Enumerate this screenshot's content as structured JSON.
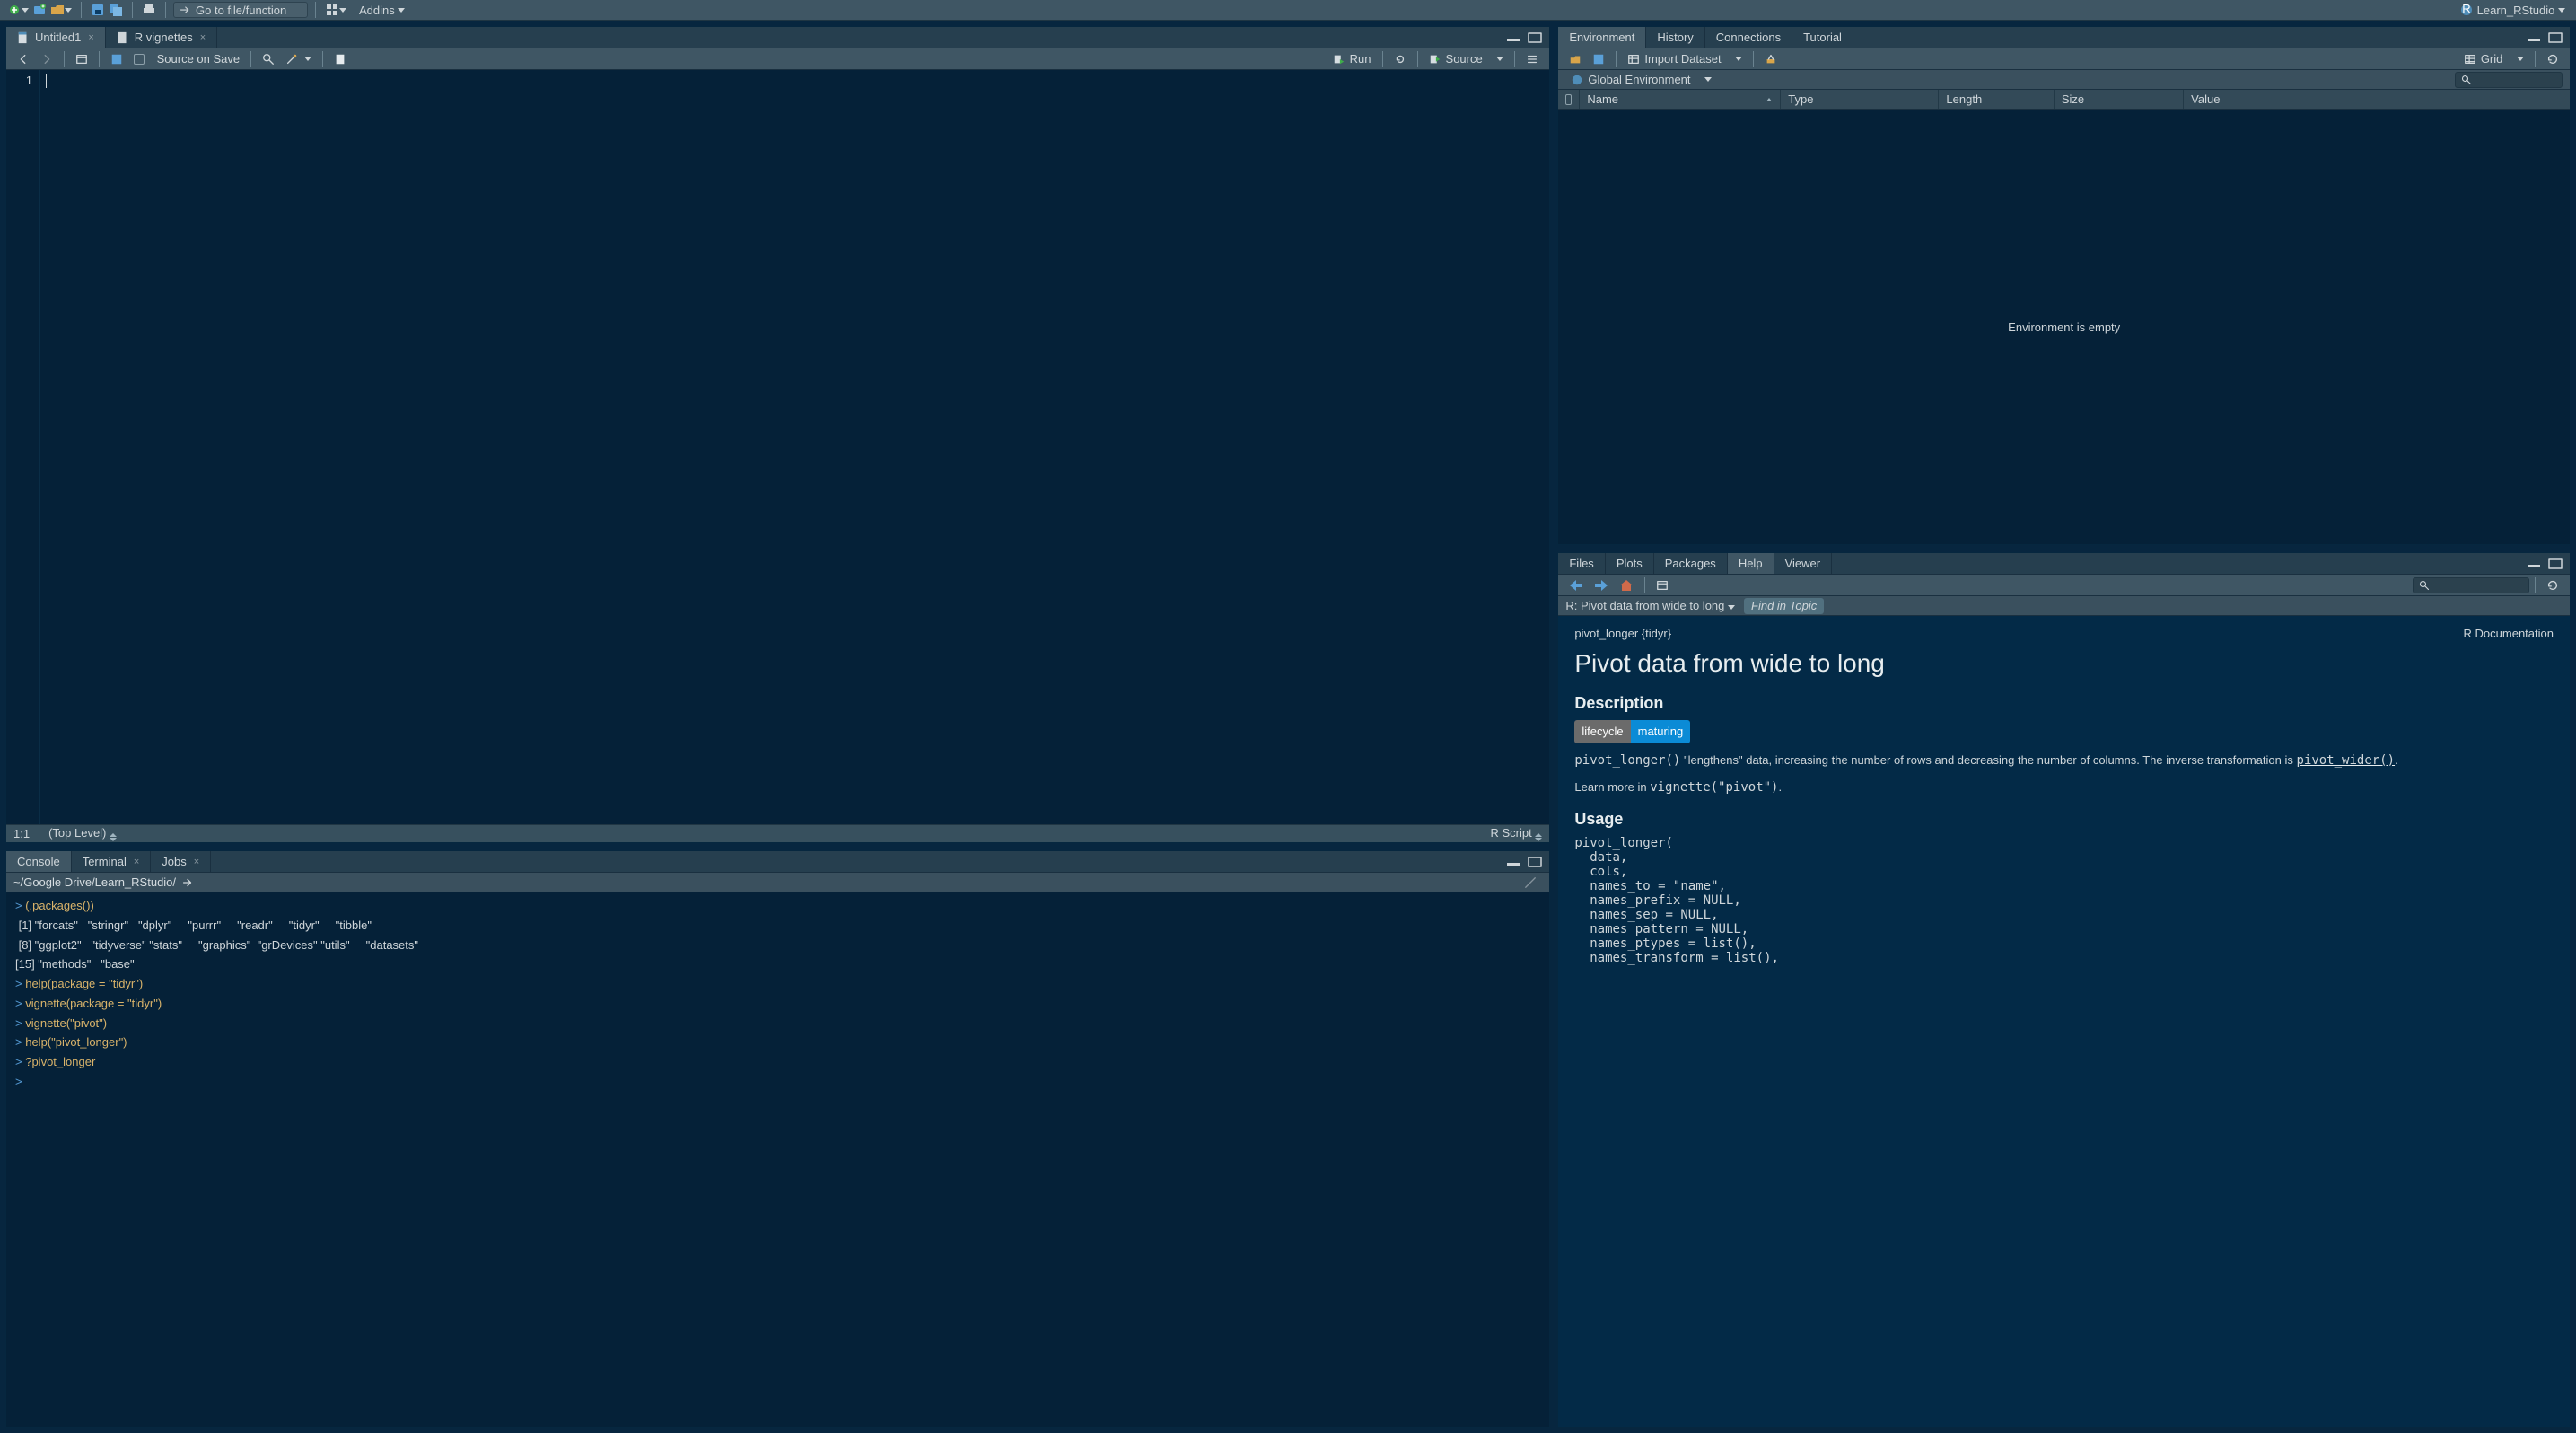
{
  "project_name": "Learn_RStudio",
  "global": {
    "goto_placeholder": "Go to file/function",
    "addins": "Addins"
  },
  "source": {
    "tabs": [
      {
        "label": "Untitled1",
        "close": true
      },
      {
        "label": "R vignettes",
        "close": true
      }
    ],
    "source_on_save": "Source on Save",
    "run": "Run",
    "source_btn": "Source",
    "gutter_first_line": "1",
    "cursor": "1:1",
    "scope": "(Top Level)",
    "lang": "R Script"
  },
  "console": {
    "tabs": [
      "Console",
      "Terminal",
      "Jobs"
    ],
    "wd": "~/Google Drive/Learn_RStudio/",
    "lines": [
      {
        "t": "cmd",
        "prompt": "> ",
        "text": "(.packages())"
      },
      {
        "t": "out",
        "text": " [1] \"forcats\"   \"stringr\"   \"dplyr\"     \"purrr\"     \"readr\"     \"tidyr\"     \"tibble\"   "
      },
      {
        "t": "out",
        "text": " [8] \"ggplot2\"   \"tidyverse\" \"stats\"     \"graphics\"  \"grDevices\" \"utils\"     \"datasets\" "
      },
      {
        "t": "out",
        "text": "[15] \"methods\"   \"base\"     "
      },
      {
        "t": "cmd",
        "prompt": "> ",
        "text": "help(package = \"tidyr\")"
      },
      {
        "t": "cmd",
        "prompt": "> ",
        "text": "vignette(package = \"tidyr\")"
      },
      {
        "t": "cmd",
        "prompt": "> ",
        "text": "vignette(\"pivot\")"
      },
      {
        "t": "cmd",
        "prompt": "> ",
        "text": "help(\"pivot_longer\")"
      },
      {
        "t": "cmd",
        "prompt": "> ",
        "text": "?pivot_longer"
      },
      {
        "t": "cmd",
        "prompt": "> ",
        "text": ""
      }
    ]
  },
  "env": {
    "tabs": [
      "Environment",
      "History",
      "Connections",
      "Tutorial"
    ],
    "import": "Import Dataset",
    "view": "Grid",
    "scope": "Global Environment",
    "cols": [
      "Name",
      "Type",
      "Length",
      "Size",
      "Value"
    ],
    "empty": "Environment is empty"
  },
  "help": {
    "tabs": [
      "Files",
      "Plots",
      "Packages",
      "Help",
      "Viewer"
    ],
    "crumb": "R: Pivot data from wide to long",
    "find_placeholder": "Find in Topic",
    "topic": "pivot_longer {tidyr}",
    "rdoc": "R Documentation",
    "title": "Pivot data from wide to long",
    "h_desc": "Description",
    "badge_l": "lifecycle",
    "badge_r": "maturing",
    "desc_pre": "pivot_longer()",
    "desc_text": " \"lengthens\" data, increasing the number of rows and decreasing the number of columns. The inverse transformation is ",
    "desc_link": "pivot_wider()",
    "learn_pre": "Learn more in ",
    "learn_code": "vignette(\"pivot\")",
    "learn_post": ".",
    "h_usage": "Usage",
    "usage": "pivot_longer(\n  data,\n  cols,\n  names_to = \"name\",\n  names_prefix = NULL,\n  names_sep = NULL,\n  names_pattern = NULL,\n  names_ptypes = list(),\n  names_transform = list(),"
  }
}
